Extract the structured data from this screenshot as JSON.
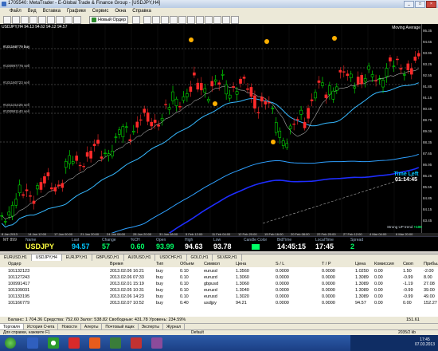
{
  "window": {
    "title": "1705540: MetaTrader - E-Global Trade & Finance Group - [USDJPY,H4]"
  },
  "menu": [
    "Файл",
    "Вид",
    "Вставка",
    "Графики",
    "Сервис",
    "Окна",
    "Справка"
  ],
  "toolbar": {
    "new_order": "Новый Ордер"
  },
  "chart": {
    "header": "USDJPY,H4  94.13 94.62 94.12 94.57",
    "indicator": "Moving Average",
    "scale_labels": [
      "95.35",
      "94.65",
      "93.95",
      "93.25",
      "92.55",
      "91.85",
      "91.15",
      "90.45",
      "89.75",
      "89.05",
      "88.35",
      "87.65",
      "86.95",
      "86.25",
      "85.55",
      "84.85",
      "84.15",
      "83.45"
    ],
    "time_labels": [
      "8 Jan 2013",
      "14 Jan 12:00",
      "17 Jan 00:00",
      "21 Jan 20:00",
      "24 Jan 08:00",
      "28 Jan 20:00",
      "31 Jan 08:00",
      "5 Feb 12:00",
      "11 Feb 04:00",
      "12 Feb 20:00",
      "15 Feb 16:00",
      "20 Feb 08:00",
      "22 Feb 20:00",
      "27 Feb 12:00",
      "4 Mar 04:00",
      "6 Mar 20:00"
    ],
    "line_labels": [
      "#101162779 buy",
      "#100997776 sell",
      "#101160723 sell",
      "#101131425 sell",
      "#100981140 sell",
      "#101166779 buy"
    ],
    "time_left_label": "Time Left",
    "time_left_value": "01:14:45",
    "strong_trend": "Strong UP trend",
    "strong_value": "+100",
    "mt_id": "MT 899"
  },
  "info_panel": {
    "headers": [
      "Name",
      "Last",
      "Change",
      "%CH",
      "Open",
      "High",
      "Low",
      "Candle Color",
      "BidTime",
      "LocalTime",
      "Spread"
    ],
    "values": [
      "USDJPY",
      "94.57",
      "57",
      "0.60",
      "93.99",
      "94.63",
      "93.78",
      "",
      "14:45:15",
      "17:45",
      "2"
    ]
  },
  "symbol_tabs": [
    "EURUSD,H1",
    "USDJPY,H4",
    "EURJPY,H1",
    "GBPUSD,H1",
    "AUDUSD,H1",
    "USDCHF,H1",
    "GOLD,H1",
    "SILVER,H1"
  ],
  "terminal": {
    "columns": [
      "Ордер",
      "Время",
      "Тип",
      "Объем",
      "Символ",
      "Цена",
      "S / L",
      "T / P",
      "Цена",
      "Комиссия",
      "Своп",
      "Прибыль"
    ],
    "rows": [
      [
        "101132123",
        "2013.02.06 16:21",
        "buy",
        "0.10",
        "eurusd",
        "1.3560",
        "0.0000",
        "0.0000",
        "1.0250",
        "0.00",
        "1.50",
        "-2.00"
      ],
      [
        "101127243",
        "2013.02.06 07:33",
        "buy",
        "0.10",
        "euruzd",
        "1.3060",
        "0.0000",
        "0.0000",
        "1.3089",
        "0.00",
        "-0.99",
        "8.00"
      ],
      [
        "100991417",
        "2013.02.01 15:19",
        "buy",
        "0.10",
        "gbpusd",
        "1.3060",
        "0.0000",
        "0.0000",
        "1.3089",
        "0.00",
        "-1.19",
        "27.08"
      ],
      [
        "101109031",
        "2013.02.05 10:31",
        "buy",
        "0.10",
        "euruzd",
        "1.3040",
        "0.0000",
        "0.0000",
        "1.3089",
        "0.00",
        "-0.99",
        "39.00"
      ],
      [
        "101133195",
        "2013.02.06 14:23",
        "buy",
        "0.10",
        "eurusd",
        "1.3020",
        "0.0000",
        "0.0000",
        "1.3089",
        "0.00",
        "-0.99",
        "49.00"
      ],
      [
        "101166779",
        "2013.02.07 10:52",
        "buy",
        "0.40",
        "usdjpy",
        "94.21",
        "0.0000",
        "0.0000",
        "94.57",
        "0.00",
        "0.00",
        "152.27"
      ]
    ],
    "balance": "Баланс: 1 704.36  Средства: 752.60  Залог: 538.82  Свободные: 431.78  Уровень: 234.59%",
    "balance_total": "151.61"
  },
  "terminal_tabs": [
    "Торговля",
    "История Счета",
    "Новости",
    "Алерты",
    "Почтовый ящик",
    "Эксперты",
    "Журнал"
  ],
  "status": {
    "left": "Для справки, нажмите F1",
    "profile": "Default",
    "traffic": "2035/2 kb"
  },
  "clock": {
    "time": "17:45",
    "date": "07.03.2013"
  },
  "colors": {
    "bull": "#00ff00",
    "bear": "#ff2a2a",
    "ma_blue": "#1e2dff",
    "ma_cyan": "#35b8ff",
    "ma_slow": "#2ea0ff"
  }
}
